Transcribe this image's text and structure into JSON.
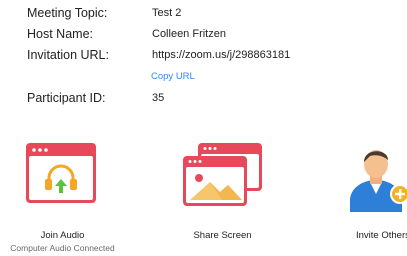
{
  "meeting_info": {
    "topic_label": "Meeting Topic:",
    "topic_value": "Test 2",
    "host_label": "Host Name:",
    "host_value": "Colleen Fritzen",
    "url_label": "Invitation URL:",
    "url_value": "https://zoom.us/j/298863181",
    "copy_url_label": "Copy URL",
    "participant_label": "Participant ID:",
    "participant_value": "35"
  },
  "actions": {
    "join_audio": {
      "label": "Join Audio",
      "status": "Computer Audio Connected",
      "icon": "headphones-icon"
    },
    "share_screen": {
      "label": "Share Screen",
      "icon": "share-screen-icon"
    },
    "invite_others": {
      "label": "Invite Others",
      "icon": "invite-person-icon"
    }
  },
  "colors": {
    "accent_red": "#e8495a",
    "link_blue": "#2d8cff",
    "headphone_orange": "#f5a623",
    "arrow_green": "#5cc23d",
    "person_blue": "#2d7fd8",
    "plus_yellow": "#f5b21e"
  }
}
